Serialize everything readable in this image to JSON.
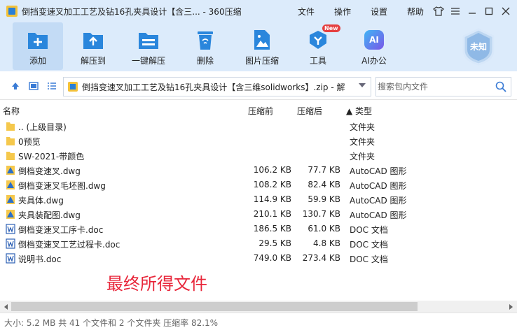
{
  "window": {
    "title": "倒挡变速叉加工工艺及钻16孔夹具设计【含三... - 360压缩",
    "menu": [
      "文件",
      "操作",
      "设置",
      "帮助"
    ]
  },
  "toolbar": {
    "buttons": [
      {
        "label": "添加",
        "icon": "add-icon"
      },
      {
        "label": "解压到",
        "icon": "extract-to-icon"
      },
      {
        "label": "一键解压",
        "icon": "one-click-extract-icon"
      },
      {
        "label": "删除",
        "icon": "trash-icon"
      },
      {
        "label": "图片压缩",
        "icon": "image-compress-icon"
      },
      {
        "label": "工具",
        "icon": "tools-icon",
        "badge": "New"
      },
      {
        "label": "AI办公",
        "icon": "ai-icon",
        "icon_text": "AI"
      }
    ],
    "badge_text": "未知"
  },
  "address": {
    "path": "倒挡变速叉加工工艺及钻16孔夹具设计【含三维solidworks】.zip - 解",
    "search_placeholder": "搜索包内文件"
  },
  "columns": {
    "name": "名称",
    "size": "压缩前",
    "packed": "压缩后",
    "type": "▲ 类型"
  },
  "files": [
    {
      "name": ".. (上级目录)",
      "size": "",
      "packed": "",
      "type": "文件夹",
      "icon": "folder-icon"
    },
    {
      "name": "0预览",
      "size": "",
      "packed": "",
      "type": "文件夹",
      "icon": "folder-icon"
    },
    {
      "name": "SW-2021-带颜色",
      "size": "",
      "packed": "",
      "type": "文件夹",
      "icon": "folder-icon"
    },
    {
      "name": "倒档变速叉.dwg",
      "size": "106.2 KB",
      "packed": "77.7 KB",
      "type": "AutoCAD 图形",
      "icon": "dwg-file-icon"
    },
    {
      "name": "倒档变速叉毛坯图.dwg",
      "size": "108.2 KB",
      "packed": "82.4 KB",
      "type": "AutoCAD 图形",
      "icon": "dwg-file-icon"
    },
    {
      "name": "夹具体.dwg",
      "size": "114.9 KB",
      "packed": "59.9 KB",
      "type": "AutoCAD 图形",
      "icon": "dwg-file-icon"
    },
    {
      "name": "夹具装配图.dwg",
      "size": "210.1 KB",
      "packed": "130.7 KB",
      "type": "AutoCAD 图形",
      "icon": "dwg-file-icon"
    },
    {
      "name": "倒档变速叉工序卡.doc",
      "size": "186.5 KB",
      "packed": "61.0 KB",
      "type": "DOC 文档",
      "icon": "word-file-icon"
    },
    {
      "name": "倒档变速叉工艺过程卡.doc",
      "size": "29.5 KB",
      "packed": "4.8 KB",
      "type": "DOC 文档",
      "icon": "word-file-icon"
    },
    {
      "name": "说明书.doc",
      "size": "749.0 KB",
      "packed": "273.4 KB",
      "type": "DOC 文档",
      "icon": "word-file-icon"
    }
  ],
  "annotation": "最终所得文件",
  "status": "大小: 5.2 MB 共 41 个文件和 2 个文件夹 压缩率 82.1%",
  "colors": {
    "chrome": "#dcebfb",
    "accent": "#2a7fd6",
    "annotation": "#e8263a"
  }
}
